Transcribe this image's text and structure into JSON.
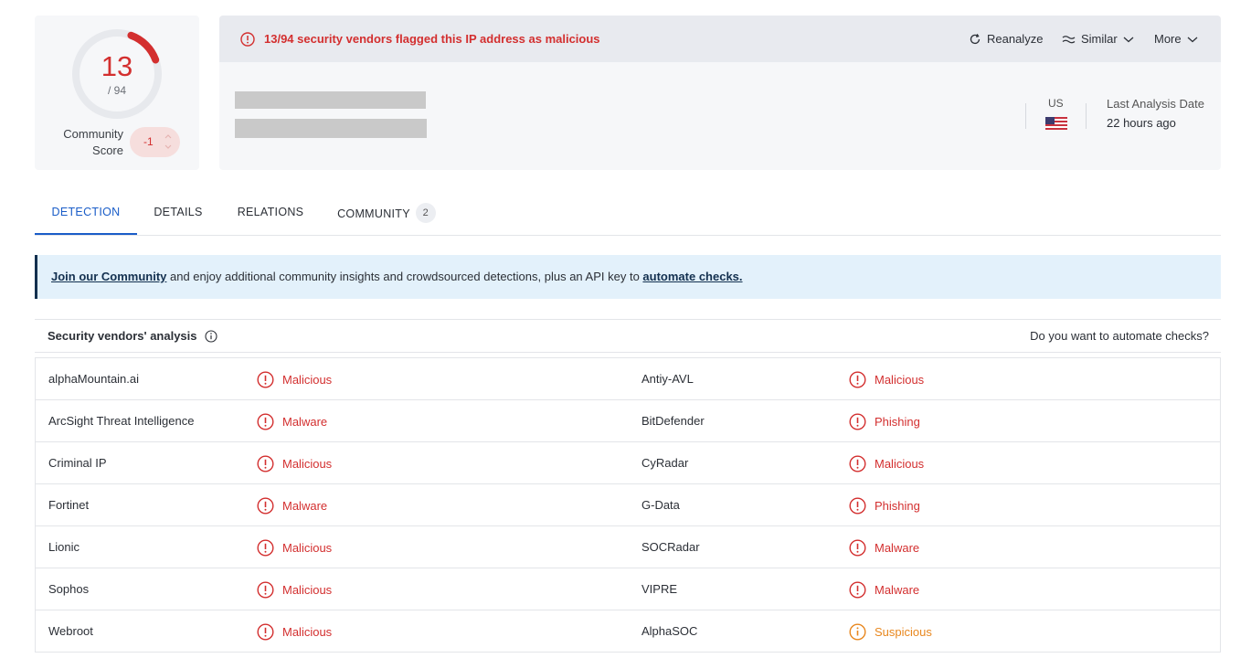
{
  "score": {
    "detections": "13",
    "total": "/ 94",
    "detections_value": 13,
    "total_value": 94,
    "community_label": "Community Score",
    "community_value": "-1"
  },
  "alert": {
    "text": "13/94 security vendors flagged this IP address as malicious"
  },
  "actions": {
    "reanalyze": "Reanalyze",
    "similar": "Similar",
    "more": "More"
  },
  "meta": {
    "country": "US",
    "last_analysis_label": "Last Analysis Date",
    "last_analysis_value": "22 hours ago"
  },
  "tabs": [
    {
      "label": "DETECTION"
    },
    {
      "label": "DETAILS"
    },
    {
      "label": "RELATIONS"
    },
    {
      "label": "COMMUNITY",
      "badge": "2"
    }
  ],
  "banner": {
    "link1": "Join our Community",
    "middle": " and enjoy additional community insights and crowdsourced detections, plus an API key to ",
    "link2": "automate checks."
  },
  "vendors_section": {
    "title": "Security vendors' analysis",
    "automate_link": "Do you want to automate checks?"
  },
  "vendors": [
    [
      {
        "name": "alphaMountain.ai",
        "result": "Malicious"
      },
      {
        "name": "Antiy-AVL",
        "result": "Malicious"
      }
    ],
    [
      {
        "name": "ArcSight Threat Intelligence",
        "result": "Malware"
      },
      {
        "name": "BitDefender",
        "result": "Phishing"
      }
    ],
    [
      {
        "name": "Criminal IP",
        "result": "Malicious"
      },
      {
        "name": "CyRadar",
        "result": "Malicious"
      }
    ],
    [
      {
        "name": "Fortinet",
        "result": "Malware"
      },
      {
        "name": "G-Data",
        "result": "Phishing"
      }
    ],
    [
      {
        "name": "Lionic",
        "result": "Malicious"
      },
      {
        "name": "SOCRadar",
        "result": "Malware"
      }
    ],
    [
      {
        "name": "Sophos",
        "result": "Malicious"
      },
      {
        "name": "VIPRE",
        "result": "Malware"
      }
    ],
    [
      {
        "name": "Webroot",
        "result": "Malicious"
      },
      {
        "name": "AlphaSOC",
        "result": "Suspicious"
      }
    ]
  ],
  "colors": {
    "malicious": "#d32f2f",
    "suspicious": "#e8871e",
    "accent": "#1a5dc8",
    "banner_link": "#13304f"
  }
}
